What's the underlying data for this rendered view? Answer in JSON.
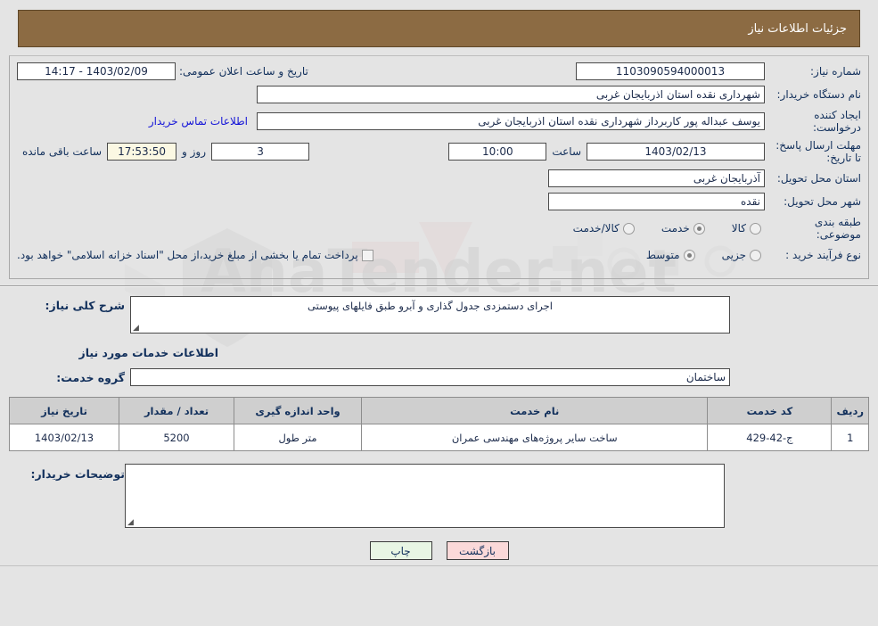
{
  "header": {
    "title": "جزئیات اطلاعات نیاز"
  },
  "info": {
    "need_number_label": "شماره نیاز:",
    "need_number_value": "1103090594000013",
    "announce_label": "تاریخ و ساعت اعلان عمومی:",
    "announce_value": "1403/02/09 - 14:17",
    "buyer_org_label": "نام دستگاه خریدار:",
    "buyer_org_value": "شهرداری نقده استان اذربایجان غربی",
    "creator_label": "ایجاد کننده درخواست:",
    "creator_value": "یوسف عبداله پور کاربرداز شهرداری نقده استان اذربایجان غربی",
    "contact_link": "اطلاعات تماس خریدار",
    "deadline_label": "مهلت ارسال پاسخ: تا تاریخ:",
    "deadline_date": "1403/02/13",
    "hour_label": "ساعت",
    "hour_value": "10:00",
    "days_value": "3",
    "days_label": "روز و",
    "timer_value": "17:53:50",
    "timer_label": "ساعت باقی مانده",
    "province_label": "استان محل تحویل:",
    "province_value": "آذربایجان غربی",
    "city_label": "شهر محل تحویل:",
    "city_value": "نقده",
    "category_label": "طبقه بندی موضوعی:",
    "category_options": [
      {
        "label": "کالا",
        "selected": false
      },
      {
        "label": "خدمت",
        "selected": true
      },
      {
        "label": "کالا/خدمت",
        "selected": false
      }
    ],
    "process_label": "نوع فرآیند خرید :",
    "process_options": [
      {
        "label": "جزیی",
        "selected": false
      },
      {
        "label": "متوسط",
        "selected": true
      }
    ],
    "treasury_checkbox_text": "پرداخت تمام یا بخشی از مبلغ خرید،از محل \"اسناد خزانه اسلامی\" خواهد بود.",
    "treasury_checked": false
  },
  "body": {
    "overall_desc_label": "شرح کلی نیاز:",
    "overall_desc_value": "اجرای دستمزدی جدول گذاری و آبرو  طبق فایلهای پیوستی",
    "services_section_title": "اطلاعات خدمات مورد نیاز",
    "service_group_label": "گروه خدمت:",
    "service_group_value": "ساختمان"
  },
  "table": {
    "columns": [
      "ردیف",
      "کد خدمت",
      "نام خدمت",
      "واحد اندازه گیری",
      "تعداد / مقدار",
      "تاریخ نیاز"
    ],
    "rows": [
      {
        "radif": "1",
        "code": "ج-42-429",
        "name": "ساخت سایر پروژه‌های مهندسی عمران",
        "unit": "متر طول",
        "qty": "5200",
        "date": "1403/02/13"
      }
    ]
  },
  "notes": {
    "label": "توضیحات خریدار:",
    "value": ""
  },
  "footer": {
    "print_label": "چاپ",
    "back_label": "بازگشت"
  },
  "colors": {
    "header_bg": "#8c6b43",
    "page_bg": "#e4e4e4",
    "link": "#1414d8",
    "table_header_bg": "#cfcfcf",
    "print_btn_bg": "#e8f6e4",
    "back_btn_bg": "#fbd9d9",
    "timer_bg": "#fbf8e3"
  },
  "watermark": {
    "text": "AnaTender.net"
  }
}
